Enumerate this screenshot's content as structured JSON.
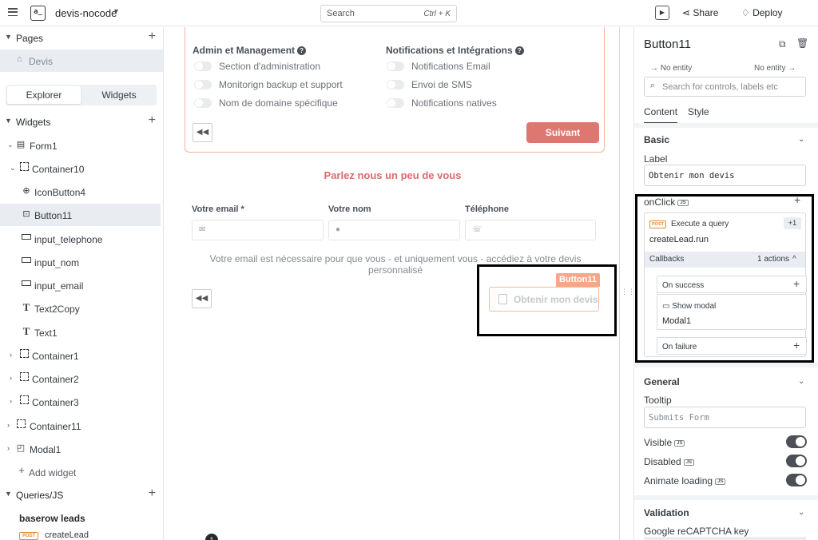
{
  "topbar": {
    "app_name": "devis-nocode",
    "logo_text": "a_",
    "search_placeholder": "Search",
    "search_shortcut": "Ctrl + K",
    "share_label": "Share",
    "deploy_label": "Deploy"
  },
  "left": {
    "pages_title": "Pages",
    "page_item": "Devis",
    "tabs": [
      "Explorer",
      "Widgets"
    ],
    "widgets_title": "Widgets",
    "tree": [
      {
        "label": "Form1"
      },
      {
        "label": "Container10"
      },
      {
        "label": "IconButton4"
      },
      {
        "label": "Button11"
      },
      {
        "label": "input_telephone"
      },
      {
        "label": "input_nom"
      },
      {
        "label": "input_email"
      },
      {
        "label": "Text2Copy"
      },
      {
        "label": "Text1"
      },
      {
        "label": "Container1"
      },
      {
        "label": "Container2"
      },
      {
        "label": "Container3"
      },
      {
        "label": "Container11"
      },
      {
        "label": "Modal1"
      }
    ],
    "add_widget": "Add widget",
    "queries_title": "Queries/JS",
    "query_group": "baserow leads",
    "query_method": "POST",
    "query_item": "createLead"
  },
  "canvas": {
    "col1_title": "Admin et Management",
    "col1_items": [
      "Section d'administration",
      "Monitorign backup et support",
      "Nom de domaine spécifique"
    ],
    "col2_title": "Notifications et Intégrations",
    "col2_items": [
      "Notifications Email",
      "Envoi de SMS",
      "Notifications natives"
    ],
    "next_button": "Suivant",
    "subtitle": "Parlez nous un peu de vous",
    "email_label": "Votre email *",
    "name_label": "Votre nom",
    "phone_label": "Téléphone",
    "note_line1": "Votre email est nécessaire pour que vous - et uniquement vous - accédiez à votre devis",
    "note_line2": "personnalisé",
    "widget_tag": "Button11",
    "cta_button": "Obtenir mon devis",
    "badge_count": "1"
  },
  "right": {
    "title": "Button11",
    "entity_left": "No entity",
    "entity_right": "No entity",
    "search_placeholder": "Search for controls, labels etc",
    "tab_content": "Content",
    "tab_style": "Style",
    "basic_title": "Basic",
    "label_title": "Label",
    "label_value": "Obtenir mon devis",
    "onclick_title": "onClick",
    "js_tag": "JS",
    "query_method": "POST",
    "action_title": "Execute a query",
    "action_more": "+1",
    "action_value": "createLead.run",
    "callbacks_title": "Callbacks",
    "callbacks_count": "1 actions",
    "on_success": "On success",
    "show_modal": "Show modal",
    "modal_value": "Modal1",
    "on_failure": "On failure",
    "general_title": "General",
    "tooltip_title": "Tooltip",
    "tooltip_value": "Submits Form",
    "visible_label": "Visible",
    "disabled_label": "Disabled",
    "animate_label": "Animate loading",
    "validation_title": "Validation",
    "recaptcha_label": "Google reCAPTCHA key"
  }
}
